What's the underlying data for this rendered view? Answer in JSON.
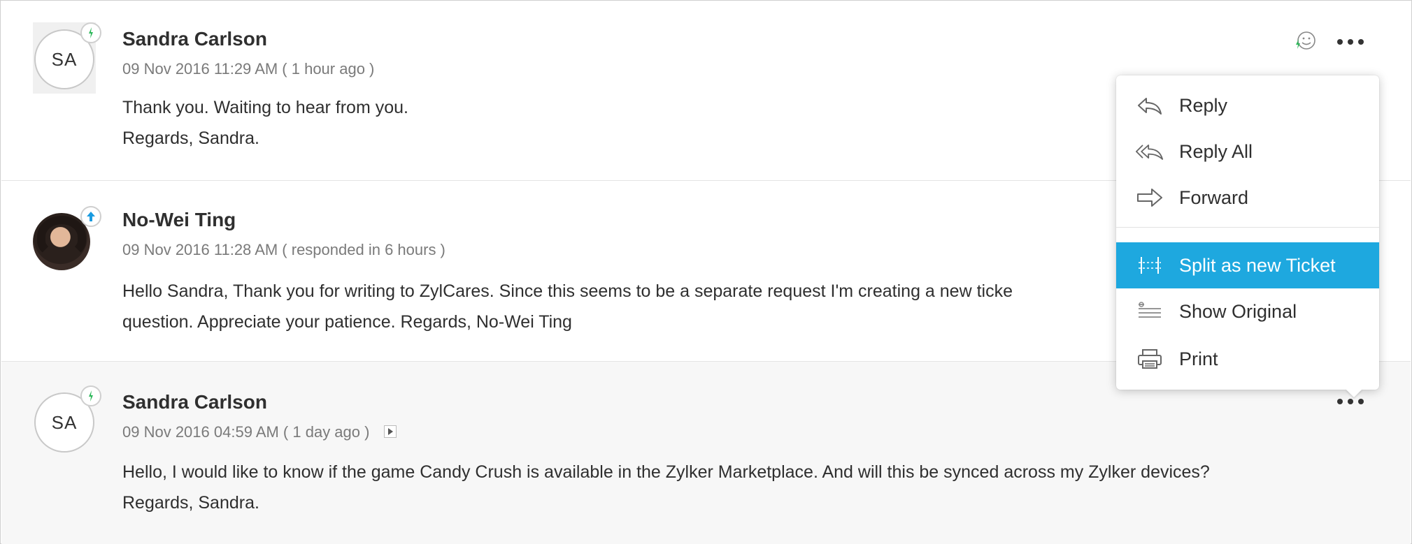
{
  "threads": [
    {
      "initials": "SA",
      "direction_icon": "arrow-down-icon",
      "sender": "Sandra Carlson",
      "timestamp": "09 Nov 2016 11:29 AM ( 1 hour ago )",
      "body_lines": [
        "Thank you. Waiting to hear from you.",
        "Regards, Sandra."
      ]
    },
    {
      "initials": "",
      "direction_icon": "arrow-up-icon",
      "sender": "No-Wei Ting",
      "timestamp": "09 Nov 2016 11:28 AM ( responded in 6 hours )",
      "body_lines": [
        "Hello Sandra, Thank you for writing to ZylCares. Since this seems to be a separate request I'm creating a new ticke",
        "question. Appreciate your patience. Regards, No-Wei Ting"
      ]
    },
    {
      "initials": "SA",
      "direction_icon": "arrow-down-icon",
      "sender": "Sandra Carlson",
      "timestamp": "09 Nov 2016 04:59 AM ( 1 day ago )",
      "body_lines": [
        "Hello, I would like to know if the game Candy Crush is available in the Zylker Marketplace. And will this be synced across my Zylker devices?",
        "Regards, Sandra."
      ]
    }
  ],
  "context_menu": {
    "items": [
      {
        "label": "Reply",
        "icon": "reply-icon"
      },
      {
        "label": "Reply All",
        "icon": "reply-all-icon"
      },
      {
        "label": "Forward",
        "icon": "forward-icon"
      },
      {
        "label": "Split as new Ticket",
        "icon": "split-icon",
        "active": true
      },
      {
        "label": "Show Original",
        "icon": "show-original-icon"
      },
      {
        "label": "Print",
        "icon": "print-icon"
      }
    ]
  },
  "colors": {
    "accent": "#1ea8df",
    "incoming_badge": "#2db85a",
    "outgoing_badge": "#1a9be0",
    "selected_thread_bg": "#f7f7f7"
  }
}
